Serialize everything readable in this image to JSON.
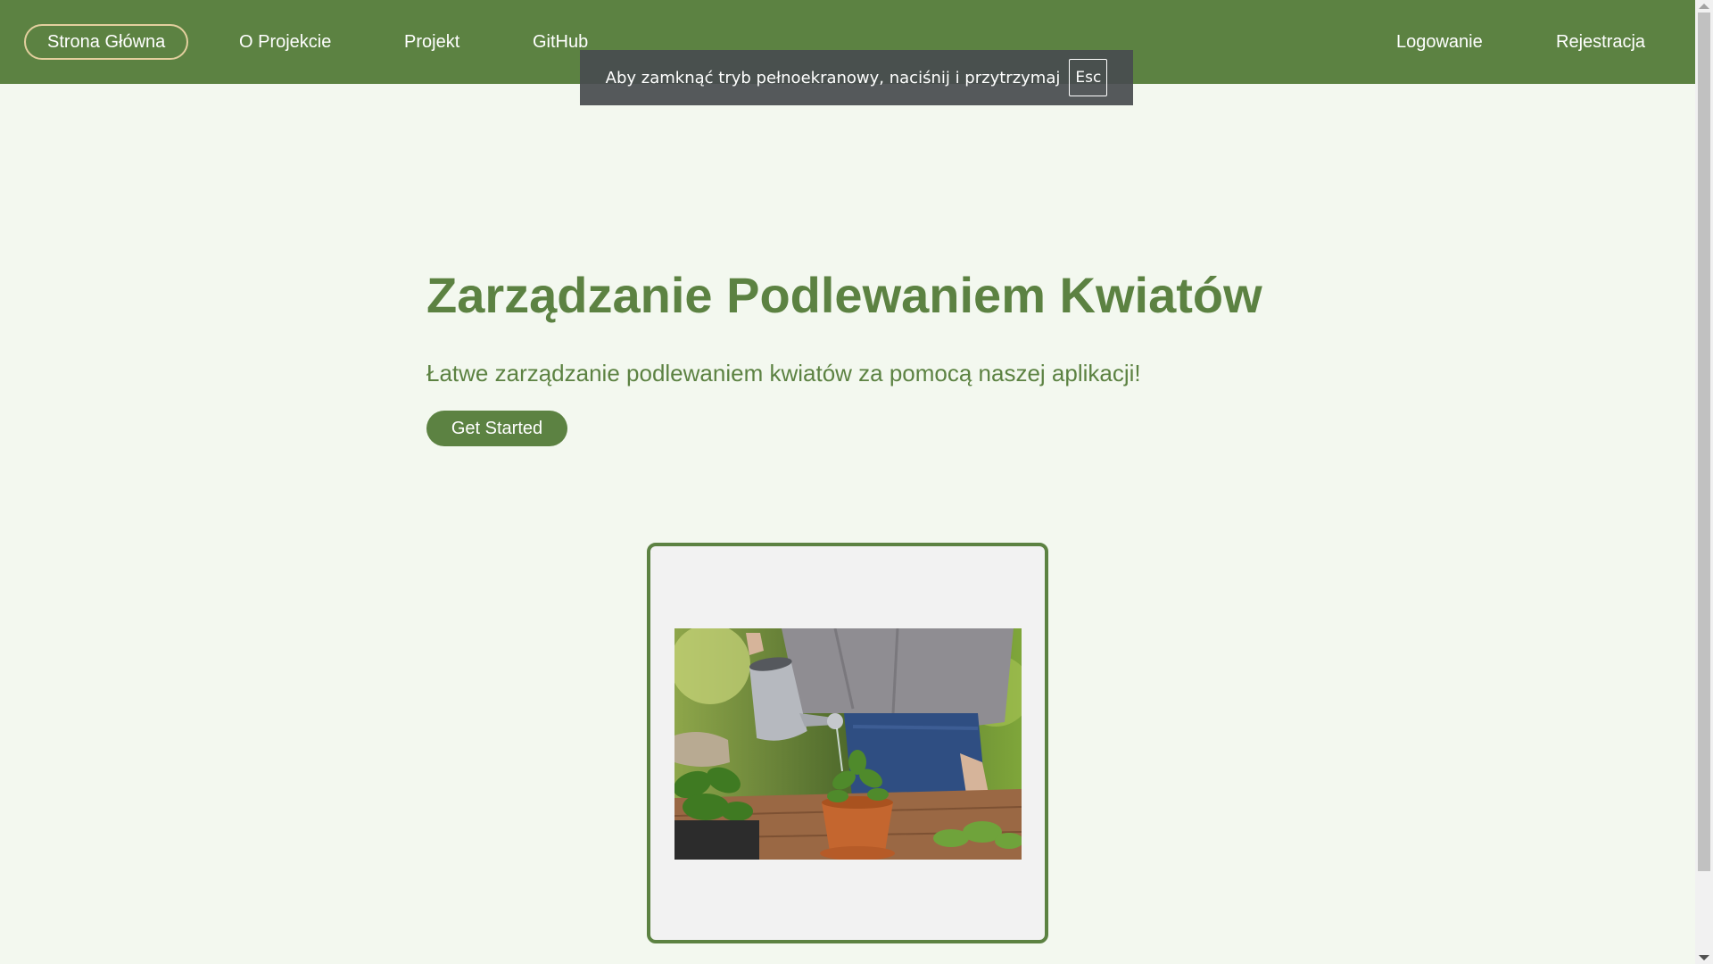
{
  "nav": {
    "home": "Strona Główna",
    "about": "O Projekcie",
    "project": "Projekt",
    "github": "GitHub",
    "login": "Logowanie",
    "register": "Rejestracja"
  },
  "fullscreen_notice": {
    "text": "Aby zamknąć tryb pełnoekranowy, naciśnij i przytrzymaj",
    "key": "Esc"
  },
  "hero": {
    "title": "Zarządzanie Podlewaniem Kwiatów",
    "subtitle": "Łatwe zarządzanie podlewaniem kwiatów za pomocą naszej aplikacji!",
    "cta_label": "Get Started"
  },
  "colors": {
    "brand_green": "#5c8242",
    "page_background": "#f3f8ef",
    "active_nav_outline": "#e3cf9e"
  },
  "image": {
    "subject": "photo of a person watering a potted basil plant with a watering can"
  }
}
